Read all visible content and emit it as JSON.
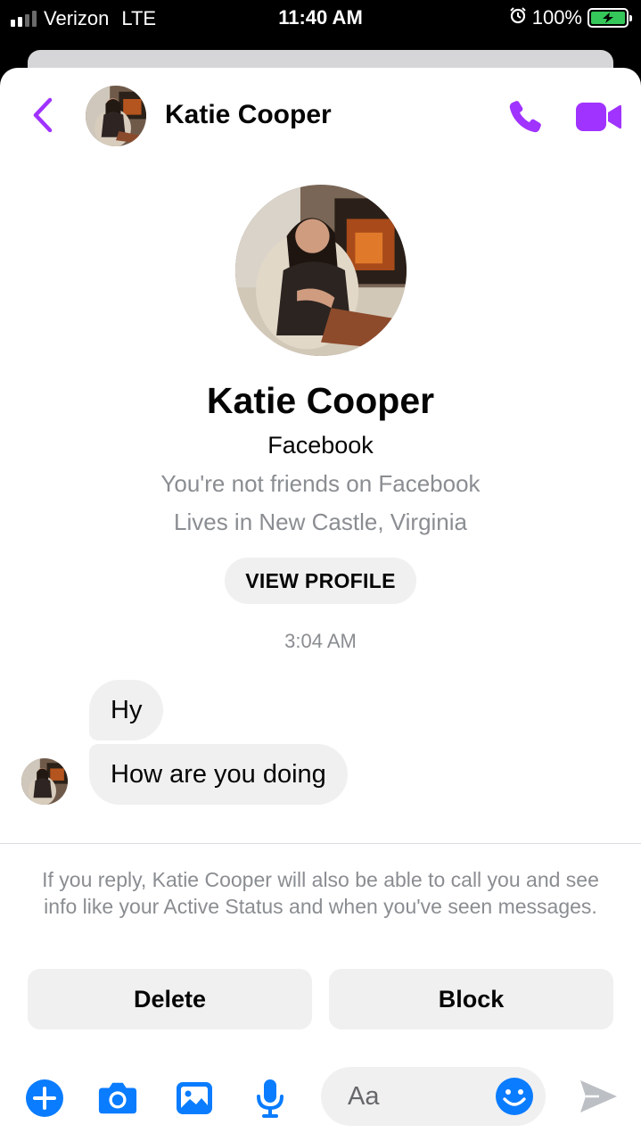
{
  "status_bar": {
    "carrier": "Verizon",
    "network": "LTE",
    "time": "11:40 AM",
    "battery": "100%"
  },
  "header": {
    "name": "Katie Cooper"
  },
  "profile": {
    "name": "Katie Cooper",
    "source": "Facebook",
    "friend_status": "You're not friends on Facebook",
    "location": "Lives in New Castle, Virginia",
    "view_profile_label": "VIEW PROFILE"
  },
  "conversation": {
    "timestamp": "3:04 AM",
    "messages": [
      {
        "text": "Hy"
      },
      {
        "text": "How are you doing"
      }
    ]
  },
  "request": {
    "notice": "If you reply, Katie Cooper will also be able to call you and see info like your Active Status and when you've seen messages.",
    "delete_label": "Delete",
    "block_label": "Block"
  },
  "composer": {
    "placeholder": "Aa"
  },
  "colors": {
    "accent": "#a033ff",
    "composer_blue": "#0a7cff",
    "bubble": "#f0f0f0",
    "secondary_text": "#8a8d91"
  }
}
